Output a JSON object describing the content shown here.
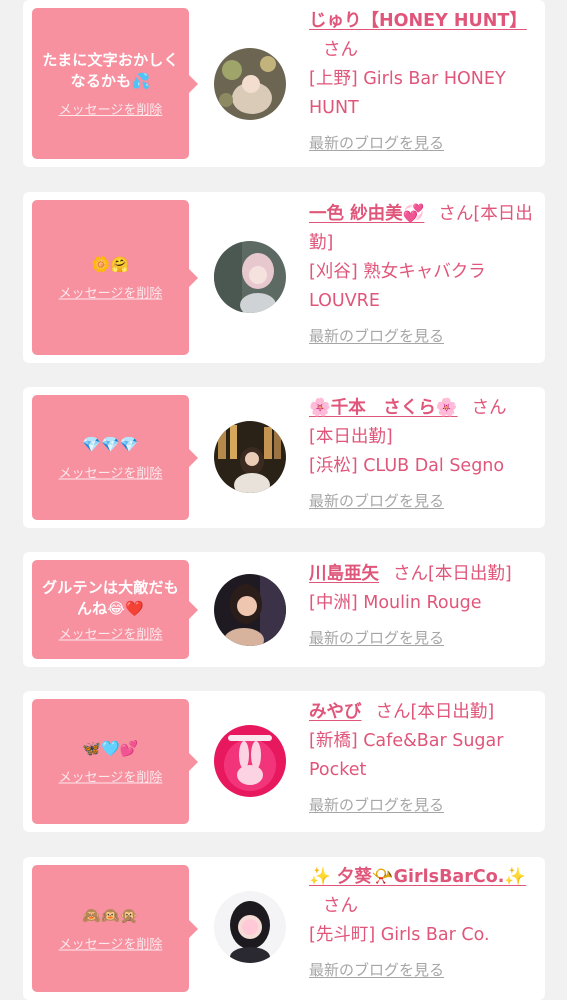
{
  "common": {
    "delete_label": "メッセージを削除",
    "blog_label": "最新のブログを見る",
    "honorific": "さん"
  },
  "colors": {
    "background": "#f1f1f1",
    "bubble": "#f7909f",
    "accent_text": "#e0567a",
    "link_gray": "#a6a6a6"
  },
  "cards": [
    {
      "message": "たまに文字おかしくなるかも💦",
      "name": "じゅり【HONEY HUNT】",
      "status": "",
      "shop": "[上野] Girls Bar HONEY HUNT",
      "avatar_icon": "avatar-photo-icon"
    },
    {
      "message": "🌼🤗",
      "name": "一色 紗由美💞",
      "status": "[本日出勤]",
      "shop": "[刈谷] 熟女キャバクラ LOUVRE",
      "avatar_icon": "avatar-photo-icon"
    },
    {
      "message": "💎💎💎",
      "name": "🌸千本　さくら🌸",
      "status": "[本日出勤]",
      "shop": "[浜松] CLUB Dal Segno",
      "avatar_icon": "avatar-photo-icon"
    },
    {
      "message": "グルテンは大敵だもんね😂❤️",
      "name": "川島亜矢",
      "status": "[本日出勤]",
      "shop": "[中洲] Moulin Rouge",
      "avatar_icon": "avatar-photo-icon"
    },
    {
      "message": "🦋🩵💕",
      "name": "みやび",
      "status": "[本日出勤]",
      "shop": "[新橋] Cafe&Bar Sugar Pocket",
      "avatar_icon": "avatar-bunny-icon"
    },
    {
      "message": "🙈🙉🙊",
      "name": "✨ 夕葵📯GirlsBarCo.✨",
      "status": "",
      "shop": "[先斗町] Girls Bar Co.",
      "avatar_icon": "avatar-photo-icon"
    }
  ]
}
